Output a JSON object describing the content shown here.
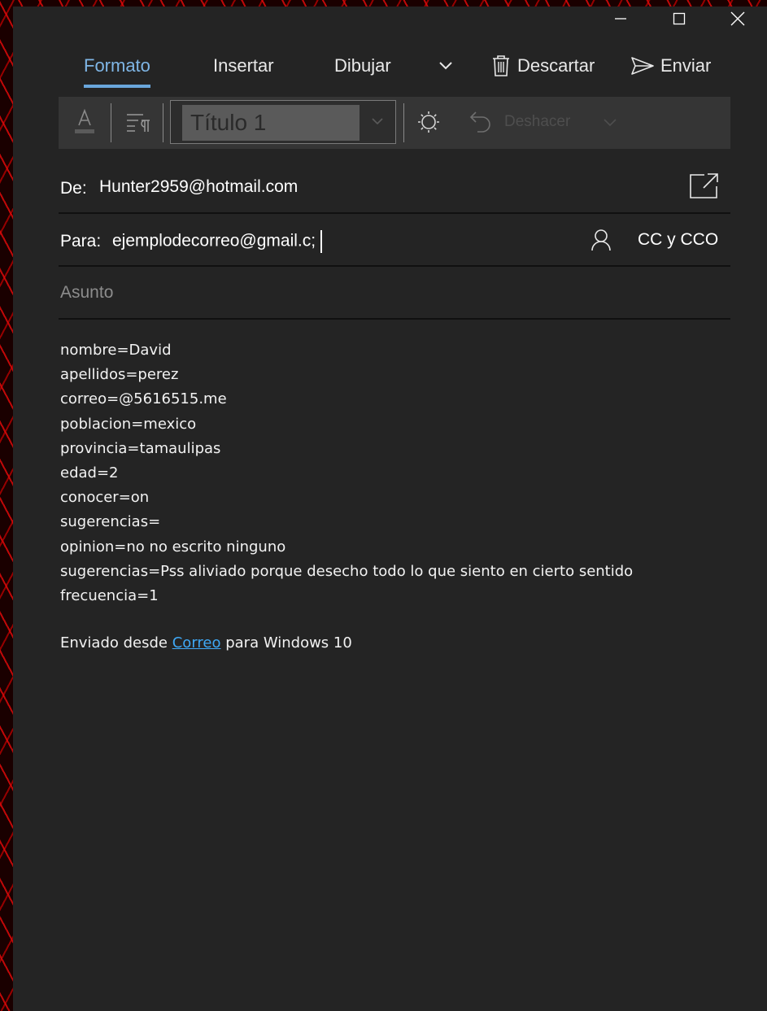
{
  "window": {
    "caption_icons": [
      "minimize-icon",
      "maximize-icon",
      "close-icon"
    ]
  },
  "tabs": {
    "items": [
      {
        "label": "Formato",
        "active": true
      },
      {
        "label": "Insertar",
        "active": false
      },
      {
        "label": "Dibujar",
        "active": false
      }
    ],
    "more_icon": "chevron-down-icon",
    "discard_label": "Descartar",
    "discard_icon": "trash-icon",
    "send_label": "Enviar",
    "send_icon": "send-icon"
  },
  "toolbar": {
    "font_color_icon": "font-color-icon",
    "paragraph_icon": "paragraph-format-icon",
    "style_value": "Título 1",
    "style_dropdown_icon": "chevron-down-icon",
    "clear_format_icon": "format-clear-icon",
    "undo_icon": "undo-icon",
    "undo_label": "Deshacer",
    "undo_more_icon": "chevron-down-icon"
  },
  "colors": {
    "accent": "#6aa6db",
    "window_bg": "#242424",
    "toolbar_bg": "#353535",
    "link": "#3fa8f5"
  },
  "header": {
    "from_label": "De:",
    "from_value": "Hunter2959@hotmail.com",
    "popout_icon": "popout-icon",
    "to_label": "Para:",
    "to_value": "ejemplodecorreo@gmail.c;",
    "contact_icon": "person-icon",
    "cc_label": "CC y CCO",
    "subject_placeholder": "Asunto"
  },
  "body": {
    "lines": [
      "nombre=David",
      "apellidos=perez",
      "correo=@5616515.me",
      "poblacion=mexico",
      "provincia=tamaulipas",
      "edad=2",
      "conocer=on",
      "sugerencias=",
      "opinion=no no escrito ninguno",
      "sugerencias=Pss aliviado porque desecho todo lo que siento en cierto sentido",
      "frecuencia=1"
    ],
    "signature_prefix": "Enviado desde ",
    "signature_link": "Correo",
    "signature_suffix": " para Windows 10"
  }
}
